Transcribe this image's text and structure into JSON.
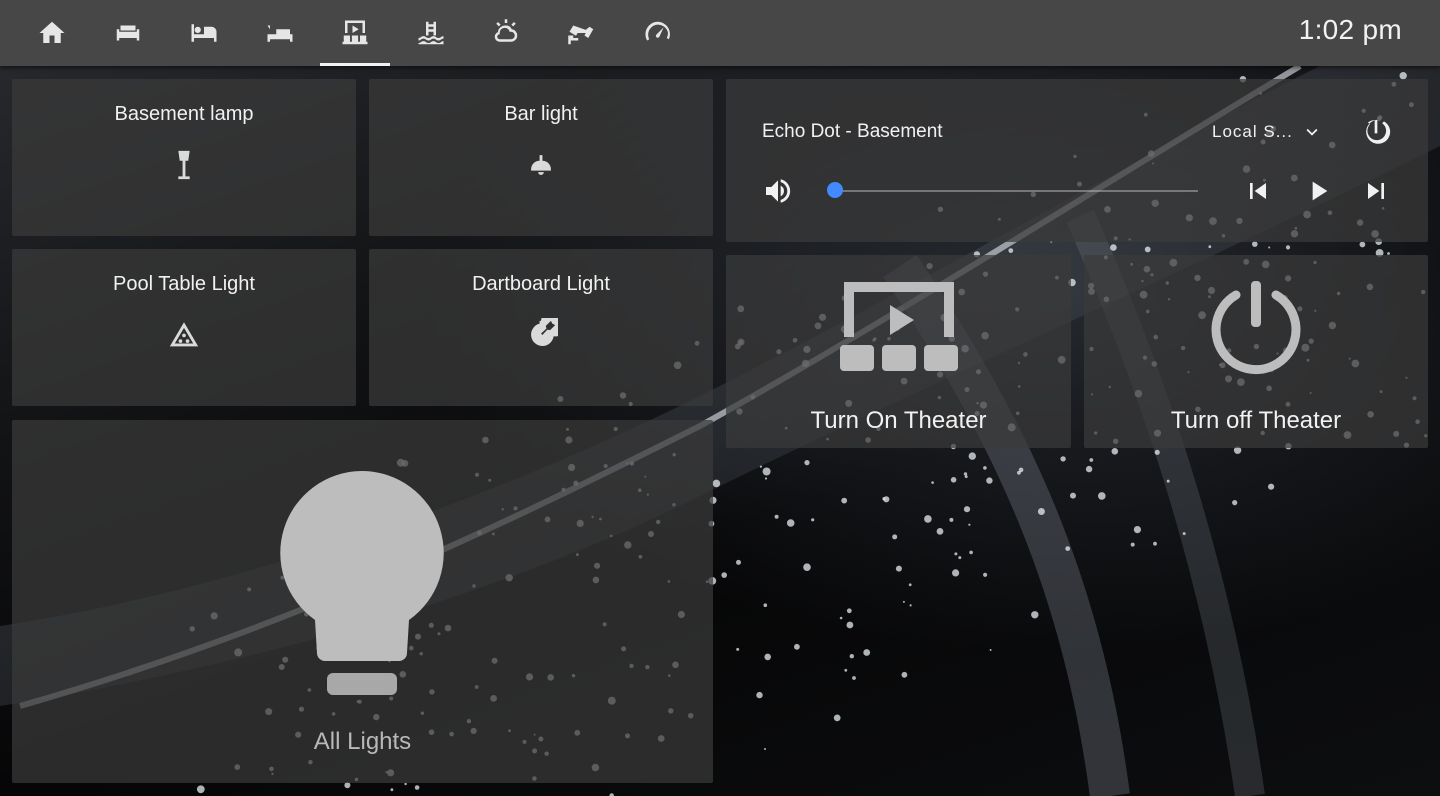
{
  "nav": {
    "tabs": [
      {
        "icon": "home-icon",
        "active": false
      },
      {
        "icon": "sofa-icon",
        "active": false
      },
      {
        "icon": "bed-person-icon",
        "active": false
      },
      {
        "icon": "bed-icon",
        "active": false
      },
      {
        "icon": "theater-icon",
        "active": true
      },
      {
        "icon": "pool-icon",
        "active": false
      },
      {
        "icon": "weather-icon",
        "active": false
      },
      {
        "icon": "cctv-icon",
        "active": false
      },
      {
        "icon": "speedometer-icon",
        "active": false
      }
    ],
    "clock": "1:02 pm"
  },
  "lights": {
    "basement_lamp": {
      "label": "Basement lamp",
      "icon": "floor-lamp-icon"
    },
    "bar_light": {
      "label": "Bar light",
      "icon": "ceiling-light-icon"
    },
    "pool_table_light": {
      "label": "Pool Table Light",
      "icon": "billiards-rack-icon"
    },
    "dartboard_light": {
      "label": "Dartboard Light",
      "icon": "bullseye-arrow-icon"
    },
    "all_lights": {
      "label": "All Lights",
      "icon": "lightbulb-icon"
    }
  },
  "media_player": {
    "name": "Echo Dot - Basement",
    "source": "Local S...",
    "volume_level": 0.02,
    "accent_color": "#448aff"
  },
  "scenes": {
    "turn_on": {
      "label": "Turn On Theater",
      "icon": "theater-icon"
    },
    "turn_off": {
      "label": "Turn off Theater",
      "icon": "power-icon"
    }
  },
  "colors": {
    "topbar": "#474747",
    "card": "#3a3a3a",
    "text": "#f1f1f1",
    "icon_inactive": "#b9b9b9"
  }
}
